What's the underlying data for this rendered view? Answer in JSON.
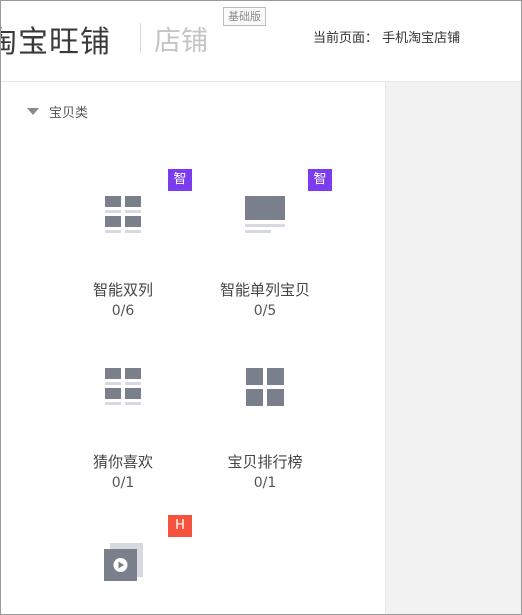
{
  "header": {
    "brand": "淘宝旺铺",
    "store_label": "店铺",
    "edition_badge": "基础版",
    "current_page": "当前页面： 手机淘宝店铺"
  },
  "category": {
    "label": "宝贝类",
    "expanded": true
  },
  "widgets": [
    {
      "name": "智能双列",
      "count": "0/6",
      "badge": "智",
      "badge_color": "#7b3cf0",
      "icon": "double-column-icon"
    },
    {
      "name": "智能单列宝贝",
      "count": "0/5",
      "badge": "智",
      "badge_color": "#7b3cf0",
      "icon": "single-column-icon"
    },
    {
      "name": "猜你喜欢",
      "count": "0/1",
      "badge": "",
      "icon": "double-column-icon"
    },
    {
      "name": "宝贝排行榜",
      "count": "0/1",
      "badge": "",
      "icon": "grid-icon"
    },
    {
      "name": "",
      "count": "",
      "badge": "H",
      "badge_color": "#f5533d",
      "icon": "video-icon"
    }
  ],
  "colors": {
    "icon_gray": "#7a7f8c",
    "icon_light": "#d6d9df",
    "panel_right_bg": "#f2f2f2"
  }
}
